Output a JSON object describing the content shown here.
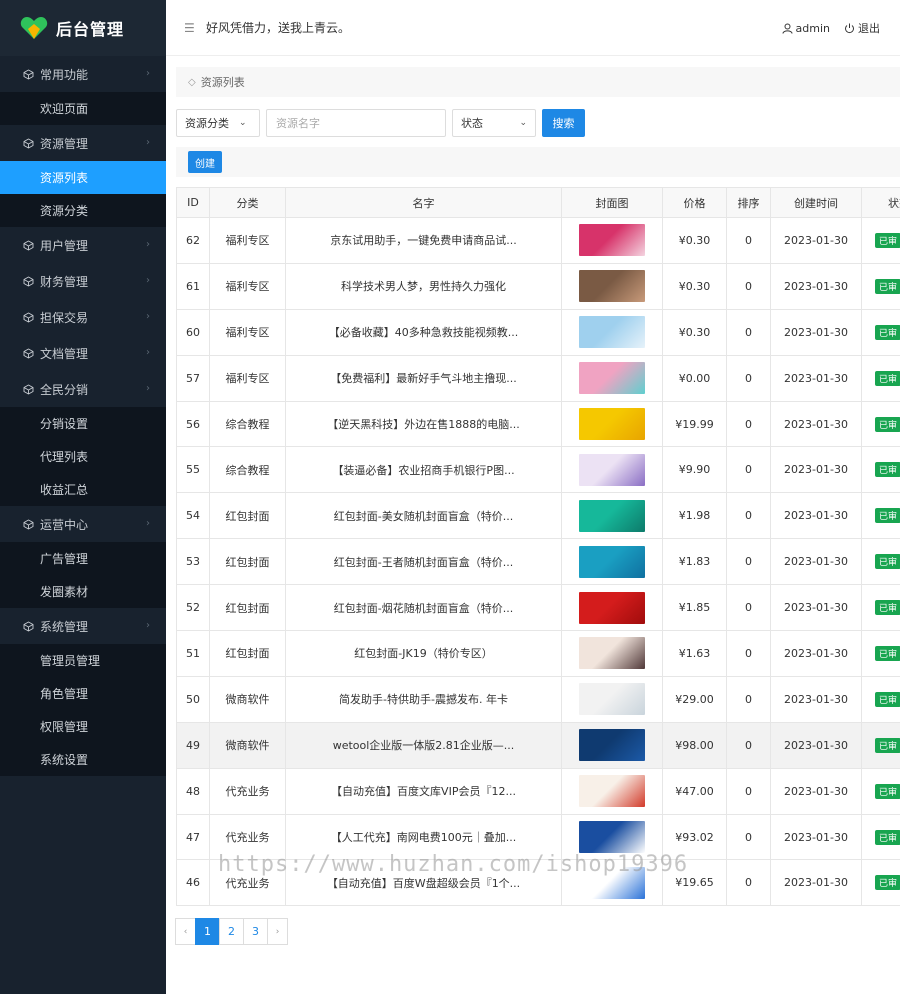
{
  "app": {
    "title": "后台管理",
    "slogan": "好风凭借力，送我上青云。",
    "user": "admin",
    "logout": "退出"
  },
  "sidebar": [
    {
      "label": "常用功能",
      "icon": "cube-icon",
      "children": [
        "欢迎页面"
      ]
    },
    {
      "label": "资源管理",
      "icon": "cube-icon",
      "children": [
        "资源列表",
        "资源分类"
      ],
      "active": "资源列表"
    },
    {
      "label": "用户管理",
      "icon": "cube-icon",
      "children": []
    },
    {
      "label": "财务管理",
      "icon": "cube-icon",
      "children": []
    },
    {
      "label": "担保交易",
      "icon": "cube-icon",
      "children": []
    },
    {
      "label": "文档管理",
      "icon": "cube-icon",
      "children": []
    },
    {
      "label": "全民分销",
      "icon": "cube-icon",
      "children": [
        "分销设置",
        "代理列表",
        "收益汇总"
      ]
    },
    {
      "label": "运营中心",
      "icon": "cube-icon",
      "children": [
        "广告管理",
        "发圈素材"
      ]
    },
    {
      "label": "系统管理",
      "icon": "cube-icon",
      "children": [
        "管理员管理",
        "角色管理",
        "权限管理",
        "系统设置"
      ]
    }
  ],
  "breadcrumb": "资源列表",
  "filters": {
    "category": "资源分类",
    "name_placeholder": "资源名字",
    "status": "状态",
    "search": "搜索"
  },
  "create_label": "创建",
  "table": {
    "columns": [
      "ID",
      "分类",
      "名字",
      "封面图",
      "价格",
      "排序",
      "创建时间",
      "状态"
    ],
    "rows": [
      {
        "id": "62",
        "cat": "福利专区",
        "name": "京东试用助手，一键免费申请商品试...",
        "price": "¥0.30",
        "sort": "0",
        "date": "2023-01-30",
        "status": "已审",
        "thumb": [
          "#d7336a",
          "#f4d4e0"
        ]
      },
      {
        "id": "61",
        "cat": "福利专区",
        "name": "科学技术男人梦，男性持久力强化",
        "price": "¥0.30",
        "sort": "0",
        "date": "2023-01-30",
        "status": "已审",
        "thumb": [
          "#7a5a44",
          "#c89a7a"
        ]
      },
      {
        "id": "60",
        "cat": "福利专区",
        "name": "【必备收藏】40多种急救技能视频教...",
        "price": "¥0.30",
        "sort": "0",
        "date": "2023-01-30",
        "status": "已审",
        "thumb": [
          "#9fd0ee",
          "#e6f2fa"
        ]
      },
      {
        "id": "57",
        "cat": "福利专区",
        "name": "【免费福利】最新好手气斗地主撸现...",
        "price": "¥0.00",
        "sort": "0",
        "date": "2023-01-30",
        "status": "已审",
        "thumb": [
          "#f0a3c2",
          "#5fcfcf"
        ]
      },
      {
        "id": "56",
        "cat": "综合教程",
        "name": "【逆天黑科技】外边在售1888的电脑...",
        "price": "¥19.99",
        "sort": "0",
        "date": "2023-01-30",
        "status": "已审",
        "thumb": [
          "#f5c800",
          "#e8a400"
        ]
      },
      {
        "id": "55",
        "cat": "综合教程",
        "name": "【装逼必备】农业招商手机银行P图...",
        "price": "¥9.90",
        "sort": "0",
        "date": "2023-01-30",
        "status": "已审",
        "thumb": [
          "#ece2f4",
          "#8a6ec4"
        ]
      },
      {
        "id": "54",
        "cat": "红包封面",
        "name": "红包封面-美女随机封面盲盒（特价...",
        "price": "¥1.98",
        "sort": "0",
        "date": "2023-01-30",
        "status": "已审",
        "thumb": [
          "#16b89a",
          "#0d7a6a"
        ]
      },
      {
        "id": "53",
        "cat": "红包封面",
        "name": "红包封面-王者随机封面盲盒（特价...",
        "price": "¥1.83",
        "sort": "0",
        "date": "2023-01-30",
        "status": "已审",
        "thumb": [
          "#1a9fc2",
          "#1070a0"
        ]
      },
      {
        "id": "52",
        "cat": "红包封面",
        "name": "红包封面-烟花随机封面盲盒（特价...",
        "price": "¥1.85",
        "sort": "0",
        "date": "2023-01-30",
        "status": "已审",
        "thumb": [
          "#d41c1c",
          "#a00c0c"
        ]
      },
      {
        "id": "51",
        "cat": "红包封面",
        "name": "红包封面-JK19（特价专区）",
        "price": "¥1.63",
        "sort": "0",
        "date": "2023-01-30",
        "status": "已审",
        "thumb": [
          "#f1e4dc",
          "#503838"
        ]
      },
      {
        "id": "50",
        "cat": "微商软件",
        "name": "简发助手-特供助手-震撼发布. 年卡",
        "price": "¥29.00",
        "sort": "0",
        "date": "2023-01-30",
        "status": "已审",
        "thumb": [
          "#f2f2f2",
          "#c9d4dc"
        ]
      },
      {
        "id": "49",
        "cat": "微商软件",
        "name": "wetool企业版一体版2.81企业版—...",
        "price": "¥98.00",
        "sort": "0",
        "date": "2023-01-30",
        "status": "已审",
        "thumb": [
          "#0f3a70",
          "#1c5aa8"
        ]
      },
      {
        "id": "48",
        "cat": "代充业务",
        "name": "【自动充值】百度文库VIP会员『12...",
        "price": "¥47.00",
        "sort": "0",
        "date": "2023-01-30",
        "status": "已审",
        "thumb": [
          "#f8f0e8",
          "#d23a2a"
        ]
      },
      {
        "id": "47",
        "cat": "代充业务",
        "name": "【人工代充】南网电费100元｜叠加...",
        "price": "¥93.02",
        "sort": "0",
        "date": "2023-01-30",
        "status": "已审",
        "thumb": [
          "#1a4ea0",
          "#ffffff"
        ]
      },
      {
        "id": "46",
        "cat": "代充业务",
        "name": "【自动充值】百度W盘超级会员『1个...",
        "price": "¥19.65",
        "sort": "0",
        "date": "2023-01-30",
        "status": "已审",
        "thumb": [
          "#ffffff",
          "#2a72d8"
        ]
      }
    ],
    "highlight_row": "49"
  },
  "pagination": {
    "prev": "‹",
    "pages": [
      "1",
      "2",
      "3"
    ],
    "current": "1",
    "next": "›"
  },
  "watermark": "https://www.huzhan.com/ishop19396"
}
